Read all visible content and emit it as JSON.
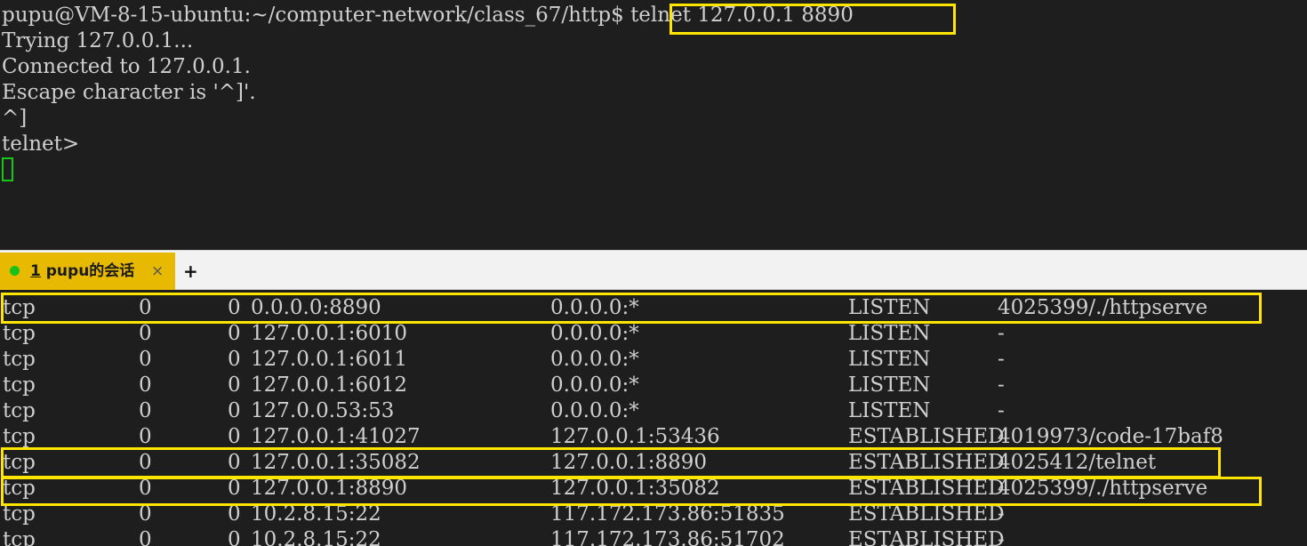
{
  "colors": {
    "terminal_bg": "#1e1e1e",
    "terminal_fg": "#cfcfcf",
    "highlight": "#ffe500",
    "tab_active": "#e7b900",
    "status_dot": "#19c219",
    "cursor": "#17c717"
  },
  "top_terminal": {
    "prompt": "pupu@VM-8-15-ubuntu:~/computer-network/class_67/http$ ",
    "command": "telnet 127.0.0.1 8890",
    "output": [
      "Trying 127.0.0.1...",
      "Connected to 127.0.0.1.",
      "Escape character is '^]'.",
      "^]",
      "telnet>"
    ]
  },
  "tabs": {
    "items": [
      {
        "number": "1",
        "label": "pupu的会话",
        "close": "×"
      }
    ],
    "add": "+"
  },
  "netstat": {
    "rows": [
      {
        "proto": "tcp",
        "recv": "0",
        "send": "0",
        "local": "0.0.0.0:8890",
        "foreign": "0.0.0.0:*",
        "state": "LISTEN",
        "pid": "4025399/./httpserve"
      },
      {
        "proto": "tcp",
        "recv": "0",
        "send": "0",
        "local": "127.0.0.1:6010",
        "foreign": "0.0.0.0:*",
        "state": "LISTEN",
        "pid": "-"
      },
      {
        "proto": "tcp",
        "recv": "0",
        "send": "0",
        "local": "127.0.0.1:6011",
        "foreign": "0.0.0.0:*",
        "state": "LISTEN",
        "pid": "-"
      },
      {
        "proto": "tcp",
        "recv": "0",
        "send": "0",
        "local": "127.0.0.1:6012",
        "foreign": "0.0.0.0:*",
        "state": "LISTEN",
        "pid": "-"
      },
      {
        "proto": "tcp",
        "recv": "0",
        "send": "0",
        "local": "127.0.0.53:53",
        "foreign": "0.0.0.0:*",
        "state": "LISTEN",
        "pid": "-"
      },
      {
        "proto": "tcp",
        "recv": "0",
        "send": "0",
        "local": "127.0.0.1:41027",
        "foreign": "127.0.0.1:53436",
        "state": "ESTABLISHED",
        "pid": "4019973/code-17baf8"
      },
      {
        "proto": "tcp",
        "recv": "0",
        "send": "0",
        "local": "127.0.0.1:35082",
        "foreign": "127.0.0.1:8890",
        "state": "ESTABLISHED",
        "pid": "4025412/telnet"
      },
      {
        "proto": "tcp",
        "recv": "0",
        "send": "0",
        "local": "127.0.0.1:8890",
        "foreign": "127.0.0.1:35082",
        "state": "ESTABLISHED",
        "pid": "4025399/./httpserve"
      },
      {
        "proto": "tcp",
        "recv": "0",
        "send": "0",
        "local": "10.2.8.15:22",
        "foreign": "117.172.173.86:51835",
        "state": "ESTABLISHED",
        "pid": "-"
      },
      {
        "proto": "tcp",
        "recv": "0",
        "send": "0",
        "local": "10.2.8.15:22",
        "foreign": "117.172.173.86:51702",
        "state": "ESTABLISHED",
        "pid": "-"
      }
    ]
  }
}
